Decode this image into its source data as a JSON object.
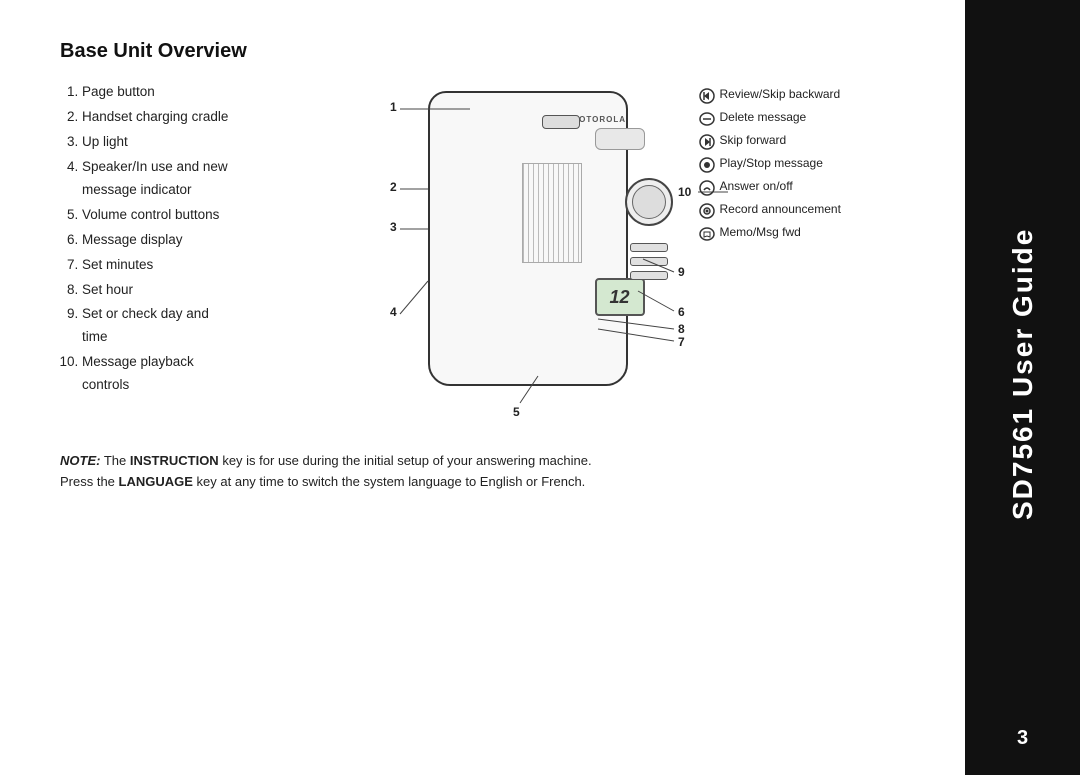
{
  "page": {
    "title": "Base Unit Overview",
    "sidebar_title": "SD7561 User Guide",
    "page_number": "3"
  },
  "list_items": [
    {
      "number": "1",
      "text": "Page button"
    },
    {
      "number": "2",
      "text": "Handset charging cradle"
    },
    {
      "number": "3",
      "text": "Up light"
    },
    {
      "number": "4",
      "text": "Speaker/In use and new message indicator"
    },
    {
      "number": "5",
      "text": "Volume control buttons"
    },
    {
      "number": "6",
      "text": "Message display"
    },
    {
      "number": "7",
      "text": "Set minutes"
    },
    {
      "number": "8",
      "text": "Set hour"
    },
    {
      "number": "9",
      "text": "Set or check day and time"
    },
    {
      "number": "10",
      "text": "Message playback controls"
    }
  ],
  "legend": [
    {
      "icon": "skip-back",
      "text": "Review/Skip backward"
    },
    {
      "icon": "delete",
      "text": "Delete message"
    },
    {
      "icon": "skip-fwd",
      "text": "Skip forward"
    },
    {
      "icon": "play-stop",
      "text": "Play/Stop message"
    },
    {
      "icon": "answer",
      "text": "Answer on/off"
    },
    {
      "icon": "record",
      "text": "Record announcement"
    },
    {
      "icon": "memo",
      "text": "Memo/Msg fwd"
    }
  ],
  "note": {
    "prefix_bold_italic": "NOTE:",
    "text1": " The ",
    "word1_bold": "INSTRUCTION",
    "text2": " key is for use during the initial setup of your answering machine.",
    "text3": "Press the ",
    "word2_bold": "LANGUAGE",
    "text4": " key at any time to switch the system language to English or French."
  },
  "device": {
    "display_text": "12",
    "brand": "MOTOROLA"
  }
}
